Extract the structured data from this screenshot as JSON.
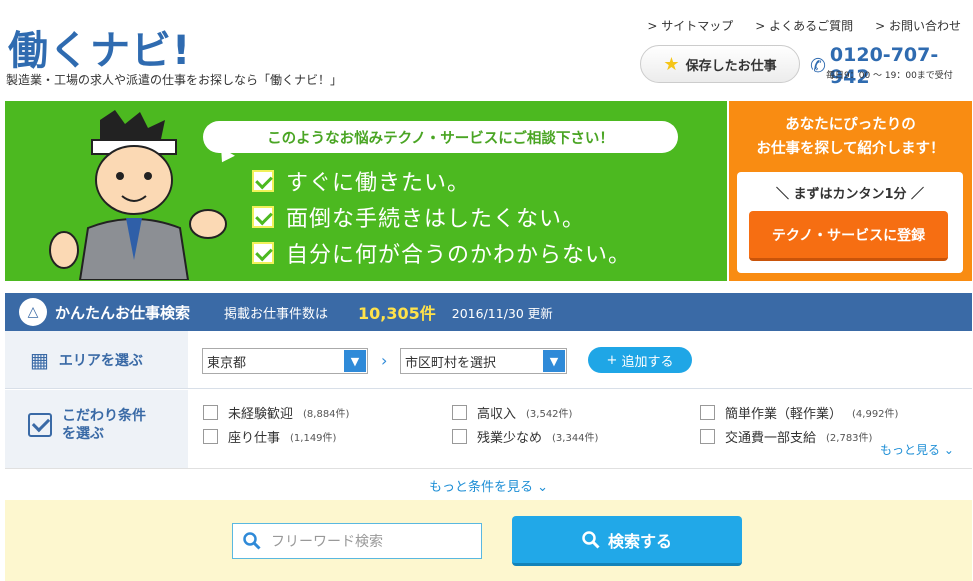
{
  "header": {
    "logo": "働くナビ!",
    "tagline": "製造業・工場の求人や派遣の仕事をお探しなら「働くナビ！」",
    "links": [
      "サイトマップ",
      "よくあるご質問",
      "お問い合わせ"
    ],
    "saved_jobs_label": "保存したお仕事",
    "phone": "0120-707-942",
    "hours": "毎日9：00 ～ 19：00まで受付"
  },
  "banner": {
    "bubble": "このようなお悩みテクノ・サービスにご相談下さい！",
    "checks": [
      "すぐに働きたい。",
      "面倒な手続きはしたくない。",
      "自分に何が合うのかわからない。"
    ],
    "orange_title_1": "あなたにぴったりの",
    "orange_title_2": "お仕事を探して紹介します！",
    "easy_text": "＼ まずはカンタン1分 ／",
    "register_label": "テクノ・サービスに登録"
  },
  "search": {
    "title": "かんたんお仕事検索",
    "count_label": "掲載お仕事件数は",
    "count": "10,305件",
    "updated": "2016/11/30 更新",
    "area_label": "エリアを選ぶ",
    "prefecture": "東京都",
    "city_placeholder": "市区町村を選択",
    "add_label": "追加する",
    "cond_label_1": "こだわり条件",
    "cond_label_2": "を選ぶ",
    "options": [
      {
        "label": "未経験歓迎",
        "count": "(8,884件)"
      },
      {
        "label": "高収入",
        "count": "(3,542件)"
      },
      {
        "label": "簡単作業（軽作業）",
        "count": "(4,992件)"
      },
      {
        "label": "座り仕事",
        "count": "(1,149件)"
      },
      {
        "label": "残業少なめ",
        "count": "(3,344件)"
      },
      {
        "label": "交通費一部支給",
        "count": "(2,783件)"
      }
    ],
    "more_label": "もっと見る ⌄",
    "more_conditions": "もっと条件を見る ⌄",
    "freeword_placeholder": "フリーワード検索",
    "search_button": "検索する"
  }
}
